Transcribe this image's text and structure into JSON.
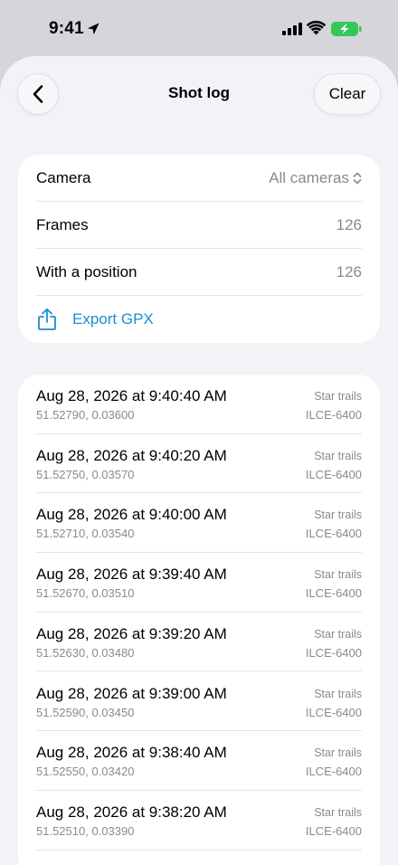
{
  "status": {
    "time": "9:41"
  },
  "nav": {
    "title": "Shot log",
    "clear_label": "Clear"
  },
  "summary": {
    "camera_label": "Camera",
    "camera_value": "All cameras",
    "frames_label": "Frames",
    "frames_value": "126",
    "position_label": "With a position",
    "position_value": "126",
    "export_label": "Export GPX"
  },
  "log": [
    {
      "time": "Aug 28, 2026 at 9:40:40 AM",
      "coords": "51.52790, 0.03600",
      "tag": "Star trails",
      "camera": "ILCE-6400"
    },
    {
      "time": "Aug 28, 2026 at 9:40:20 AM",
      "coords": "51.52750, 0.03570",
      "tag": "Star trails",
      "camera": "ILCE-6400"
    },
    {
      "time": "Aug 28, 2026 at 9:40:00 AM",
      "coords": "51.52710, 0.03540",
      "tag": "Star trails",
      "camera": "ILCE-6400"
    },
    {
      "time": "Aug 28, 2026 at 9:39:40 AM",
      "coords": "51.52670, 0.03510",
      "tag": "Star trails",
      "camera": "ILCE-6400"
    },
    {
      "time": "Aug 28, 2026 at 9:39:20 AM",
      "coords": "51.52630, 0.03480",
      "tag": "Star trails",
      "camera": "ILCE-6400"
    },
    {
      "time": "Aug 28, 2026 at 9:39:00 AM",
      "coords": "51.52590, 0.03450",
      "tag": "Star trails",
      "camera": "ILCE-6400"
    },
    {
      "time": "Aug 28, 2026 at 9:38:40 AM",
      "coords": "51.52550, 0.03420",
      "tag": "Star trails",
      "camera": "ILCE-6400"
    },
    {
      "time": "Aug 28, 2026 at 9:38:20 AM",
      "coords": "51.52510, 0.03390",
      "tag": "Star trails",
      "camera": "ILCE-6400"
    }
  ],
  "colors": {
    "accent": "#1a8ed6",
    "battery": "#34c759",
    "background": "#f2f2f7"
  },
  "icons": {
    "location": "location-arrow-icon",
    "signal": "cellular-signal-icon",
    "wifi": "wifi-icon",
    "battery": "battery-charging-icon",
    "back": "chevron-left-icon",
    "camera_picker": "chevron-up-down-icon",
    "export": "share-icon"
  }
}
